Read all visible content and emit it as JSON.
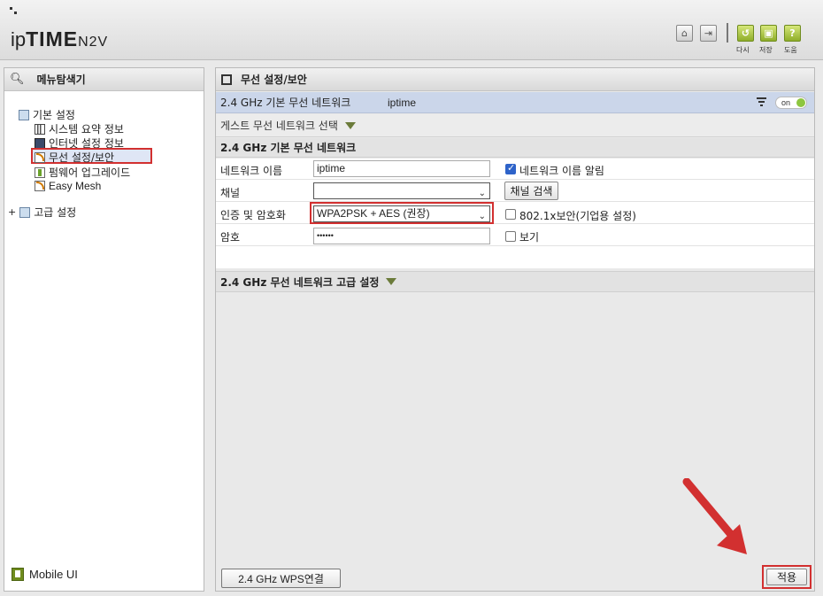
{
  "header": {
    "logo_ip": "ip",
    "logo_time": "TIME",
    "logo_model": "N2V",
    "buttons": [
      {
        "name": "home-icon",
        "label": ""
      },
      {
        "name": "logout-icon",
        "label": ""
      },
      {
        "name": "reload-icon",
        "label": "다시"
      },
      {
        "name": "save-icon",
        "label": "저장"
      },
      {
        "name": "help-icon",
        "label": "도움"
      }
    ]
  },
  "left": {
    "title": "메뉴탐색기",
    "basic": "기본 설정",
    "items": [
      "시스템 요약 정보",
      "인터넷 설정 정보",
      "무선 설정/보안",
      "펌웨어 업그레이드",
      "Easy Mesh"
    ],
    "advanced": "고급 설정",
    "mobile": "Mobile UI"
  },
  "right": {
    "title": "무선 설정/보안",
    "net_label": "2.4 GHz 기본 무선 네트워크",
    "net_ssid": "iptime",
    "toggle": "on",
    "guest": "게스트 무선 네트워크 선택",
    "section": "2.4 GHz 기본 무선 네트워크",
    "fields": {
      "name_label": "네트워크 이름",
      "name_value": "iptime",
      "broadcast": "네트워크 이름 알림",
      "channel_label": "채널",
      "channel_value": "",
      "channel_search": "채널 검색",
      "auth_label": "인증 및 암호화",
      "auth_value": "WPA2PSK + AES (권장)",
      "enterprise": "802.1x보안(기업용 설정)",
      "pw_label": "암호",
      "pw_value": "••••••",
      "show": "보기"
    },
    "advanced": "2.4 GHz 무선 네트워크 고급 설정",
    "wps": "2.4 GHz WPS연결",
    "apply": "적용"
  },
  "colors": {
    "highlight": "#d23030",
    "selected_row": "#cbd6ea",
    "accent_green": "#8dc63f"
  }
}
